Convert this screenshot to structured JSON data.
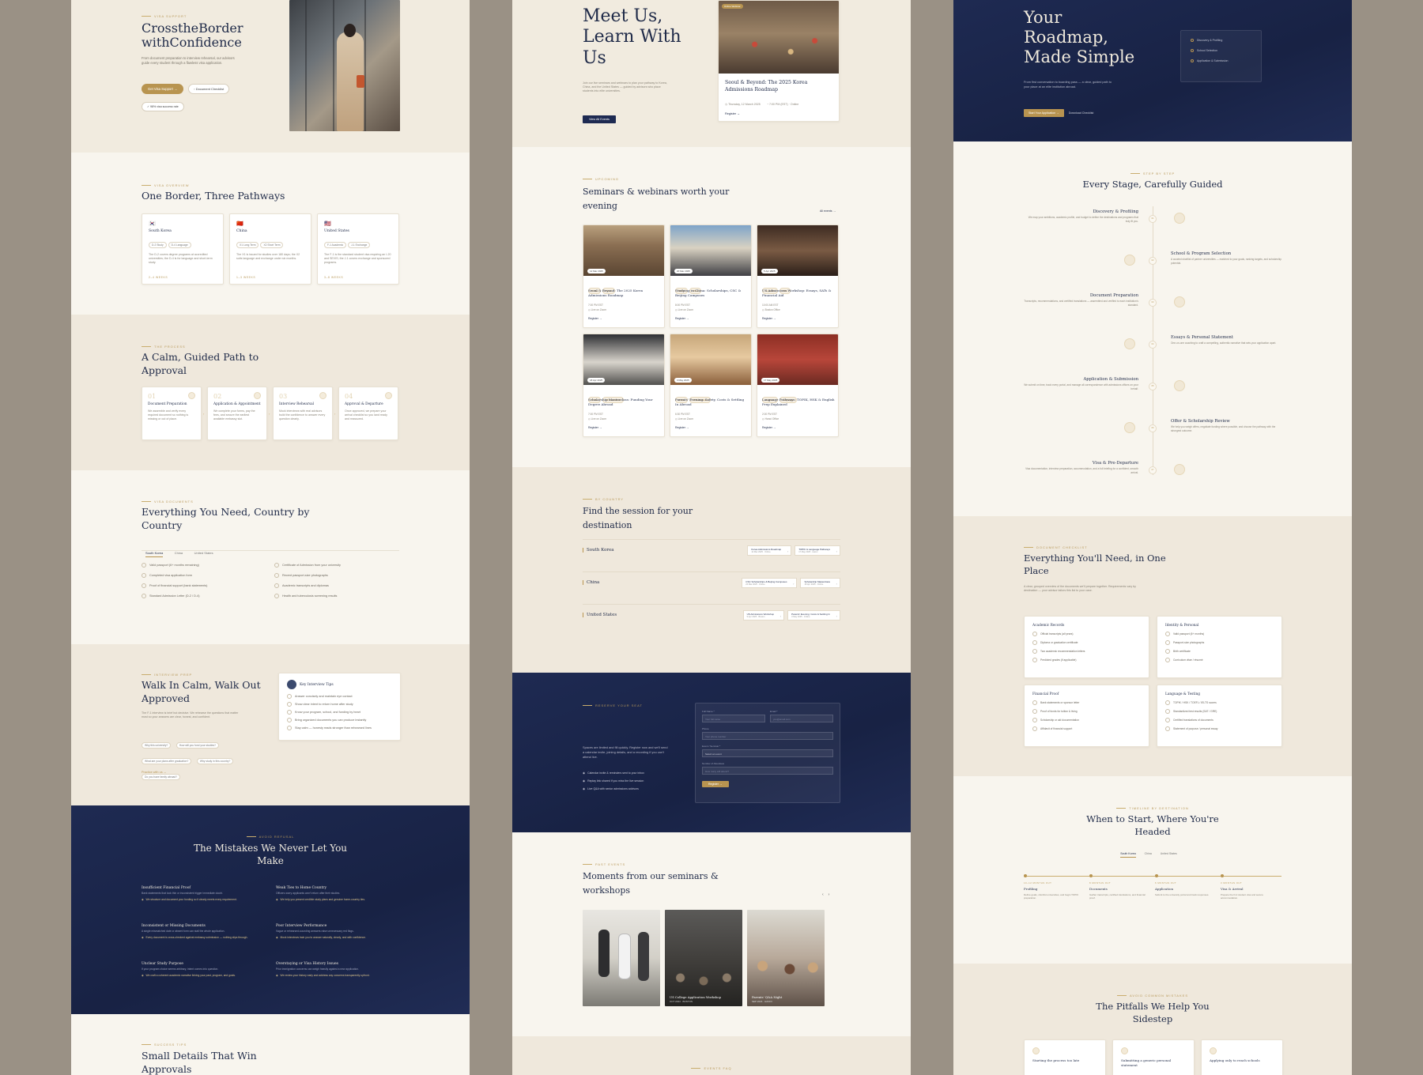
{
  "panel1": {
    "hero": {
      "eyebrow": "Visa Support",
      "title_line1": "CrosstheBorder",
      "title_line2": "withConfidence",
      "desc": "From document preparation to interview rehearsal, our advisors guide every student through a flawless visa application.",
      "btn_primary": "Get Visa Support →",
      "btn_secondary": "Document Checklist",
      "badge": "98% visa success rate"
    },
    "overview": {
      "eyebrow": "Visa Overview",
      "title": "One Border, Three Pathways",
      "cards": [
        {
          "flag": "🇰🇷",
          "name": "South Korea",
          "chips": [
            "D-2 Study",
            "D-4 Language"
          ],
          "desc": "The D-2 covers degree programs at accredited universities; the D-4 is for language and short-term study.",
          "foot": "2–4 weeks"
        },
        {
          "flag": "🇨🇳",
          "name": "China",
          "chips": [
            "X1 Long Term",
            "X2 Short Term"
          ],
          "desc": "The X1 is issued for studies over 180 days; the X2 suits language and exchange under six months.",
          "foot": "1–3 weeks"
        },
        {
          "flag": "🇺🇸",
          "name": "United States",
          "chips": [
            "F-1 Academic",
            "J-1 Exchange"
          ],
          "desc": "The F-1 is the standard student visa requiring an I-20 and SEVIS; the J-1 covers exchange and sponsored programs.",
          "foot": "3–8 weeks"
        }
      ]
    },
    "process": {
      "eyebrow": "The Process",
      "title_line1": "A Calm, Guided Path to",
      "title_line2": "Approval",
      "steps": [
        {
          "num": "01",
          "title": "Document Preparation",
          "desc": "We assemble and verify every required document so nothing is missing or out of place."
        },
        {
          "num": "02",
          "title": "Application & Appointment",
          "desc": "We complete your forms, pay the fees, and secure the earliest available embassy slot."
        },
        {
          "num": "03",
          "title": "Interview Rehearsal",
          "desc": "Mock interviews with real advisors build the confidence to answer every question clearly."
        },
        {
          "num": "04",
          "title": "Approval & Departure",
          "desc": "Once approved, we prepare your arrival checklist so you land ready and reassured."
        }
      ]
    },
    "documents": {
      "eyebrow": "Visa Documents",
      "title_line1": "Everything You Need, Country by",
      "title_line2": "Country",
      "tabs": [
        "South Korea",
        "China",
        "United States"
      ],
      "left": [
        "Valid passport (6+ months remaining)",
        "Completed visa application form",
        "Proof of financial support (bank statements)",
        "Standard Admission Letter (D-2 / D-4)"
      ],
      "right": [
        "Certificate of Admission from your university",
        "Recent passport-size photographs",
        "Academic transcripts and diplomas",
        "Health and tuberculosis screening results"
      ]
    },
    "interview": {
      "eyebrow": "Interview Prep",
      "title_line1": "Walk In Calm, Walk Out",
      "title_line2": "Approved",
      "desc": "The F-1 interview is brief but decisive. We rehearse the questions that matter most so your answers are clear, honest, and confident.",
      "questions": [
        "Why this university?",
        "How will you fund your studies?",
        "What are your plans after graduation?",
        "Why study in this country?",
        "Do you have family abroad?"
      ],
      "link": "Practice with us →",
      "tips_title": "Key Interview Tips",
      "tips": [
        "Answer concisely and maintain eye contact",
        "Show clear intent to return home after study",
        "Know your program, school, and funding by heart",
        "Bring organized documents you can produce instantly",
        "Stay calm — honesty reads stronger than rehearsed lines"
      ]
    },
    "mistakes": {
      "eyebrow": "Avoid Refusal",
      "title_line1": "The Mistakes We Never Let You",
      "title_line2": "Make",
      "items": [
        {
          "title": "Insufficient Financial Proof",
          "desc": "Bank statements that look thin or inconsistent trigger immediate doubt.",
          "fix": "We structure and document your funding so it clearly meets every requirement."
        },
        {
          "title": "Weak Ties to Home Country",
          "desc": "Officers worry applicants won't return after their studies.",
          "fix": "We help you present credible study plans and genuine home-country ties."
        },
        {
          "title": "Inconsistent or Missing Documents",
          "desc": "A single mismatched date or absent form can stall the whole application.",
          "fix": "Every document is cross-checked against embassy submission — nothing slips through."
        },
        {
          "title": "Poor Interview Performance",
          "desc": "Vague or rehearsed-sounding answers raise unnecessary red flags.",
          "fix": "Mock interviews train you to answer naturally, clearly, and with confidence."
        },
        {
          "title": "Unclear Study Purpose",
          "desc": "If your program choice seems arbitrary, intent comes into question.",
          "fix": "We craft a coherent academic narrative linking your past, program, and goals."
        },
        {
          "title": "Overstaying or Visa History Issues",
          "desc": "Prior immigration concerns can weigh heavily against a new application.",
          "fix": "We review your history early and address any concerns transparently upfront."
        }
      ]
    },
    "tips": {
      "eyebrow": "Success Tips",
      "title_line1": "Small Details That Win",
      "title_line2": "Approvals"
    }
  },
  "panel2": {
    "hero": {
      "title_line1": "Meet Us,",
      "title_line2": "Learn With",
      "title_line3": "Us",
      "desc": "Join our live seminars and webinars to plan your pathway to Korea, China, and the United States — guided by advisors who place students into elite universities.",
      "btn": "View All Events",
      "featured": {
        "badge": "Online Webinar",
        "title_line1": "Seoul & Beyond: The 2025 Korea",
        "title_line2": "Admissions Roadmap",
        "date": "Thursday, 12 March 2025",
        "time": "7:00 PM (EST) · Online",
        "link": "Register →"
      }
    },
    "upcoming": {
      "eyebrow": "Upcoming",
      "title_line1": "Seminars & webinars worth your",
      "title_line2": "evening",
      "all_link": "All events →",
      "events": [
        {
          "date": "12 Mar 2025",
          "chips": [
            "Online",
            "Korea"
          ],
          "title": "Seoul & Beyond: The 2025 Korea Admissions Roadmap",
          "time": "7:00 PM EST",
          "place": "Live on Zoom",
          "link": "Register →"
        },
        {
          "date": "20 Mar 2025",
          "chips": [
            "Online",
            "China"
          ],
          "title": "Studying in China: Scholarships, CSC & Beijing Campuses",
          "time": "8:00 PM EST",
          "place": "Live on Zoom",
          "link": "Register →"
        },
        {
          "date": "5 Apr 2025",
          "chips": [
            "In-person",
            "USA"
          ],
          "title": "US Admissions Workshop: Essays, SATs & Financial Aid",
          "time": "10:00 AM EST",
          "place": "Boston Office",
          "link": "Register →"
        },
        {
          "date": "18 Apr 2025",
          "chips": [
            "Online",
            "All Destinations"
          ],
          "title": "Scholarship Masterclass: Funding Your Degree Abroad",
          "time": "7:00 PM EST",
          "place": "Live on Zoom",
          "link": "Register →"
        },
        {
          "date": "3 May 2025",
          "chips": [
            "Online",
            "All Destinations"
          ],
          "title": "Parents' Evening: Safety, Costs & Settling In Abroad",
          "time": "6:30 PM EST",
          "place": "Live on Zoom",
          "link": "Register →"
        },
        {
          "date": "17 May 2025",
          "chips": [
            "In-person",
            "Languages"
          ],
          "title": "Language Pathways: TOPIK, HSK & English Prep Explained",
          "time": "2:00 PM EST",
          "place": "Hanoi Office",
          "link": "Register →"
        }
      ]
    },
    "bycountry": {
      "eyebrow": "By Country",
      "title_line1": "Find the session for your",
      "title_line2": "destination",
      "rows": [
        {
          "country": "South Korea",
          "pills": [
            {
              "t": "Korea Admissions Roadmap",
              "s": "12 Mar 2025 · Online"
            },
            {
              "t": "TOPIK & Language Pathways",
              "s": "17 May 2025 · Hanoi"
            }
          ]
        },
        {
          "country": "China",
          "pills": [
            {
              "t": "CSC Scholarships & Beijing Campuses",
              "s": "20 Mar 2025 · Online"
            },
            {
              "t": "Scholarship Masterclass",
              "s": "18 Apr 2025 · Online"
            }
          ]
        },
        {
          "country": "United States",
          "pills": [
            {
              "t": "US Admissions Workshop",
              "s": "5 Apr 2025 · Boston"
            },
            {
              "t": "Parents' Evening: Costs & Settling In",
              "s": "3 May 2025 · Online"
            }
          ]
        }
      ]
    },
    "reserve": {
      "eyebrow": "Reserve Your Seat",
      "desc": "Spaces are limited and fill quickly. Register now and we'll send a calendar invite, joining details, and a recording if you can't attend live.",
      "checks": [
        "Calendar invite & reminders sent to your inbox",
        "Replay link shared if you miss the live session",
        "Live Q&A with senior admissions advisors"
      ],
      "form": {
        "label_name": "Full Name *",
        "ph_name": "Your full name",
        "label_email": "Email *",
        "ph_email": "you@email.com",
        "label_phone": "Phone",
        "ph_phone": "Your phone number",
        "label_event": "Event / Seminar *",
        "ph_event": "Select an event",
        "label_att": "Number of Attendees",
        "ph_att": "How many will attend?",
        "submit": "Register →"
      }
    },
    "moments": {
      "eyebrow": "Past Events",
      "title_line1": "Moments from our seminars &",
      "title_line2": "workshops",
      "photos": [
        {
          "caption": "",
          "sub": ""
        },
        {
          "caption": "US College Application Workshop",
          "sub": "OCT 2024 · BOSTON"
        },
        {
          "caption": "Parents' Q&A Night",
          "sub": "SEP 2024 · HANOI"
        }
      ]
    },
    "bottom_eyebrow": "Events FAQ"
  },
  "panel3": {
    "hero": {
      "title_line1": "Your",
      "title_line2": "Roadmap,",
      "title_line3": "Made Simple",
      "desc": "From first conversation to boarding pass — a clear, guided path to your place at an elite institution abroad.",
      "btn": "Start Your Application →",
      "link": "Download Checklist",
      "nav": [
        "Discovery & Profiling",
        "School Selection",
        "Application & Submission"
      ]
    },
    "stages": {
      "eyebrow": "Step by Step",
      "title": "Every Stage, Carefully Guided",
      "items": [
        {
          "num": "01",
          "title": "Discovery & Profiling",
          "desc": "We map your ambitions, academic profile, and budget to define the destinations and programs that truly fit you.",
          "side": "left"
        },
        {
          "num": "02",
          "title": "School & Program Selection",
          "desc": "A curated shortlist of partner universities — matched to your goals, ranking targets, and scholarship potential.",
          "side": "right"
        },
        {
          "num": "03",
          "title": "Document Preparation",
          "desc": "Transcripts, recommendations, and certified translations — assembled and verified to each institution's standard.",
          "side": "left"
        },
        {
          "num": "04",
          "title": "Essays & Personal Statement",
          "desc": "One-on-one coaching to craft a compelling, authentic narrative that sets your application apart.",
          "side": "right"
        },
        {
          "num": "05",
          "title": "Application & Submission",
          "desc": "We submit on time, track every portal, and manage all correspondence with admissions offices on your behalf.",
          "side": "left"
        },
        {
          "num": "06",
          "title": "Offer & Scholarship Review",
          "desc": "We help you weigh offers, negotiate funding where possible, and choose the pathway with the strongest outcome.",
          "side": "right"
        },
        {
          "num": "07",
          "title": "Visa & Pre-Departure",
          "desc": "Visa documentation, interview preparation, accommodation, and a full briefing for a confident, smooth arrival.",
          "side": "left"
        }
      ]
    },
    "checklist": {
      "eyebrow": "Document Checklist",
      "title_line1": "Everything You'll Need, in One",
      "title_line2": "Place",
      "desc": "A clear, grouped overview of the documents we'll prepare together. Requirements vary by destination — your advisor tailors this list to your case.",
      "groups": [
        {
          "title": "Academic Records",
          "items": [
            "Official transcripts (all years)",
            "Diploma or graduation certificate",
            "Two academic recommendation letters",
            "Predicted grades (if applicable)"
          ]
        },
        {
          "title": "Identity & Personal",
          "items": [
            "Valid passport (6+ months)",
            "Passport-size photographs",
            "Birth certificate",
            "Curriculum vitae / résumé"
          ]
        },
        {
          "title": "Financial Proof",
          "items": [
            "Bank statements or sponsor letter",
            "Proof of funds for tuition & living",
            "Scholarship or aid documentation",
            "Affidavit of financial support"
          ]
        },
        {
          "title": "Language & Testing",
          "items": [
            "TOPIK / HSK / TOEFL / IELTS scores",
            "Standardized test results (SAT / GRE)",
            "Certified translations of documents",
            "Statement of purpose / personal essay"
          ]
        }
      ]
    },
    "timeline": {
      "eyebrow": "Timeline by Destination",
      "title_line1": "When to Start, Where You're",
      "title_line2": "Headed",
      "tabs": [
        "South Korea",
        "China",
        "United States"
      ],
      "points": [
        {
          "when": "10–12 months out",
          "title": "Profiling",
          "desc": "Define goals, shortlist universities, and begin TOPIK preparation."
        },
        {
          "when": "8 months out",
          "title": "Documents",
          "desc": "Gather transcripts, certified translations, and financial proof."
        },
        {
          "when": "6 months out",
          "title": "Application",
          "desc": "Submit to the university portal and track responses."
        },
        {
          "when": "3 months out",
          "title": "Visa & Arrival",
          "desc": "Prepare the D-2 student visa and secure accommodation."
        }
      ]
    },
    "pitfalls": {
      "eyebrow": "Avoid Common Mistakes",
      "title_line1": "The Pitfalls We Help You",
      "title_line2": "Sidestep",
      "cards": [
        "Starting the process too late",
        "Submitting a generic personal statement",
        "Applying only to reach schools"
      ]
    }
  }
}
